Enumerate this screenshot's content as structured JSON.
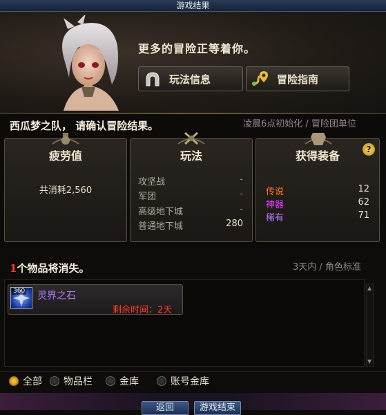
{
  "window": {
    "title": "游戏结果"
  },
  "header": {
    "tagline": "更多的冒险正等着你。",
    "buttons": [
      {
        "label": "玩法信息",
        "icon": "horseshoe-arch-icon"
      },
      {
        "label": "冒险指南",
        "icon": "map-route-icon"
      }
    ]
  },
  "confirm": {
    "message": "西瓜梦之队， 请确认冒险结果。",
    "reset_note": "凌晨6点初始化 / 冒险团单位"
  },
  "panels": {
    "fatigue": {
      "title": "疲劳值",
      "consumed": "共消耗2,560"
    },
    "mode": {
      "title": "玩法",
      "rows": [
        {
          "name": "攻坚战",
          "value": "-"
        },
        {
          "name": "军团",
          "value": "-"
        },
        {
          "name": "高级地下城",
          "value": "-"
        },
        {
          "name": "普通地下城",
          "value": "280"
        }
      ]
    },
    "loot": {
      "title": "获得装备",
      "help": "?",
      "rows": [
        {
          "name": "传说",
          "value": "12",
          "color": "#ff7a1a"
        },
        {
          "name": "神器",
          "value": "62",
          "color": "#e23cff"
        },
        {
          "name": "稀有",
          "value": "71",
          "color": "#b07cff"
        }
      ]
    }
  },
  "vanishing": {
    "count": "1",
    "title_suffix": "个物品将消失。",
    "right_note": "3天内 / 角色标准",
    "items": [
      {
        "name": "灵界之石",
        "badge": "360",
        "remaining": "剩余时间：2天"
      }
    ]
  },
  "filters": [
    {
      "label": "全部",
      "selected": true
    },
    {
      "label": "物品栏",
      "selected": false
    },
    {
      "label": "金库",
      "selected": false
    },
    {
      "label": "账号金库",
      "selected": false
    }
  ],
  "footer": {
    "buttons": [
      "返回",
      "游戏结束"
    ]
  }
}
